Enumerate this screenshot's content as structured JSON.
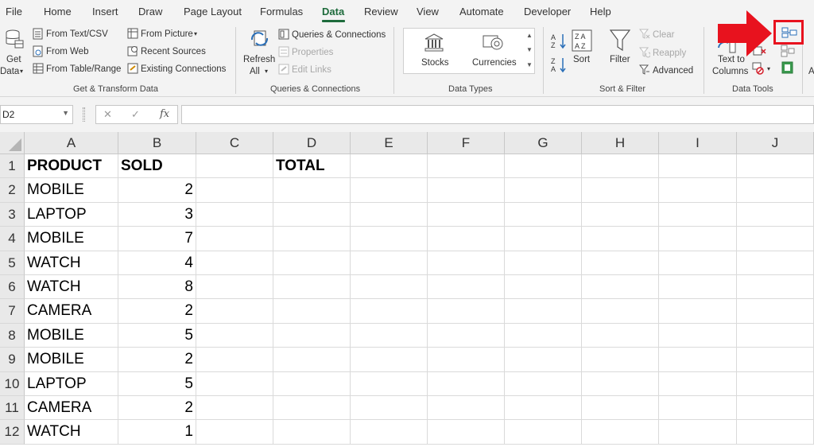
{
  "menu": {
    "tabs": [
      "File",
      "Home",
      "Insert",
      "Draw",
      "Page Layout",
      "Formulas",
      "Data",
      "Review",
      "View",
      "Automate",
      "Developer",
      "Help"
    ],
    "active": "Data"
  },
  "ribbon": {
    "get_transform": {
      "get_data": [
        "Get",
        "Data"
      ],
      "from_text_csv": "From Text/CSV",
      "from_web": "From Web",
      "from_table_range": "From Table/Range",
      "from_picture": "From Picture",
      "recent_sources": "Recent Sources",
      "existing_connections": "Existing Connections",
      "label": "Get & Transform Data"
    },
    "queries": {
      "refresh_all": [
        "Refresh",
        "All"
      ],
      "queries_connections": "Queries & Connections",
      "properties": "Properties",
      "edit_links": "Edit Links",
      "label": "Queries & Connections"
    },
    "data_types": {
      "stocks": "Stocks",
      "currencies": "Currencies",
      "label": "Data Types"
    },
    "sort_filter": {
      "sort": "Sort",
      "filter": "Filter",
      "clear": "Clear",
      "reapply": "Reapply",
      "advanced": "Advanced",
      "label": "Sort & Filter"
    },
    "data_tools": {
      "text_to_columns": [
        "Text to",
        "Columns"
      ],
      "label": "Data Tools"
    },
    "clipped_next_letter": "A"
  },
  "formula_bar": {
    "name_box": "D2",
    "cancel_symbol": "✕",
    "enter_symbol": "✓",
    "function_symbol": "fx",
    "formula": ""
  },
  "sheet": {
    "columns": [
      "A",
      "B",
      "C",
      "D",
      "E",
      "F",
      "G",
      "H",
      "I",
      "J"
    ],
    "rows": [
      "1",
      "2",
      "3",
      "4",
      "5",
      "6",
      "7",
      "8",
      "9",
      "10",
      "11",
      "12"
    ],
    "headers": {
      "A": "PRODUCT",
      "B": "SOLD",
      "D": "TOTAL"
    },
    "data": [
      {
        "product": "MOBILE",
        "sold": "2"
      },
      {
        "product": "LAPTOP",
        "sold": "3"
      },
      {
        "product": "MOBILE",
        "sold": "7"
      },
      {
        "product": "WATCH",
        "sold": "4"
      },
      {
        "product": "WATCH",
        "sold": "8"
      },
      {
        "product": "CAMERA",
        "sold": "2"
      },
      {
        "product": "MOBILE",
        "sold": "5"
      },
      {
        "product": "MOBILE",
        "sold": "2"
      },
      {
        "product": "LAPTOP",
        "sold": "5"
      },
      {
        "product": "CAMERA",
        "sold": "2"
      },
      {
        "product": "WATCH",
        "sold": "1"
      }
    ],
    "selected_cell": "D2"
  },
  "annotation": {
    "arrow_color": "#e8121e",
    "highlight_color": "#e8121e"
  },
  "colors": {
    "accent": "#1e6b3c",
    "ribbon_bg": "#f3f3f3",
    "header_bg": "#e9e9e9"
  }
}
